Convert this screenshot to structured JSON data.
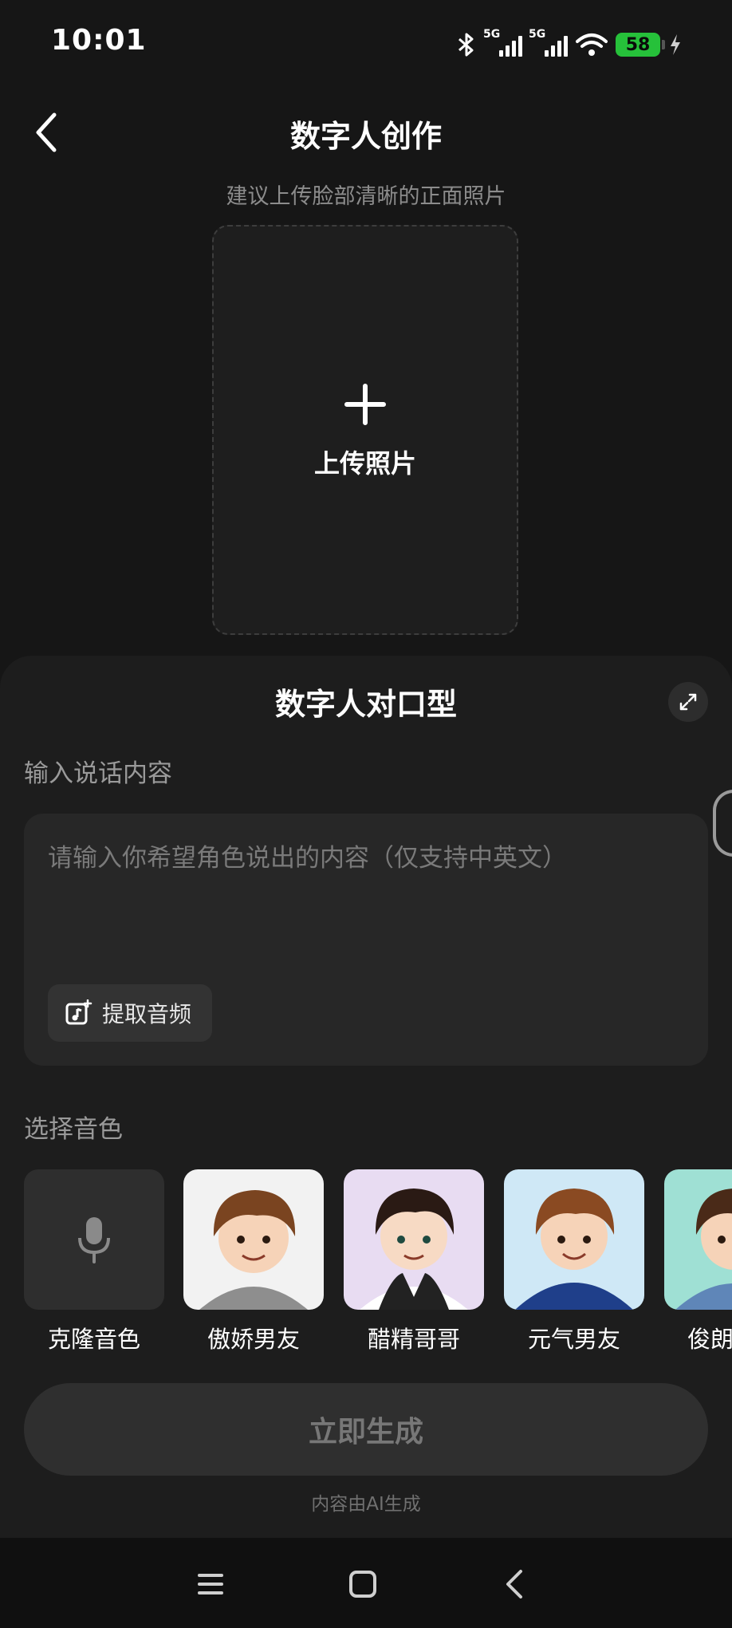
{
  "status_bar": {
    "time": "10:01",
    "network_1": "5G",
    "network_2": "5G",
    "battery": "58",
    "icons": [
      "bluetooth-icon",
      "signal-icon",
      "signal-icon",
      "wifi-icon",
      "battery-icon",
      "charging-icon"
    ]
  },
  "header": {
    "title": "数字人创作",
    "back_icon": "chevron-left-icon"
  },
  "upload": {
    "hint": "建议上传脸部清晰的正面照片",
    "label": "上传照片",
    "icon": "plus-icon"
  },
  "panel": {
    "title": "数字人对口型",
    "expand_icon": "expand-icon",
    "content_label": "输入说话内容",
    "placeholder": "请输入你希望角色说出的内容（仅支持中英文）",
    "extract_audio": "提取音频",
    "voice_label": "选择音色",
    "voices": [
      {
        "label": "克隆音色",
        "icon": "microphone-icon"
      },
      {
        "label": "傲娇男友"
      },
      {
        "label": "醋精哥哥"
      },
      {
        "label": "元气男友"
      },
      {
        "label": "俊朗"
      }
    ],
    "generate_button": "立即生成",
    "ai_note": "内容由AI生成"
  },
  "colors": {
    "background": "#161616",
    "panel": "#1d1d1d",
    "battery": "#26c13a"
  },
  "nav_bar": {
    "icons": [
      "menu-icon",
      "home-icon",
      "back-icon"
    ]
  }
}
